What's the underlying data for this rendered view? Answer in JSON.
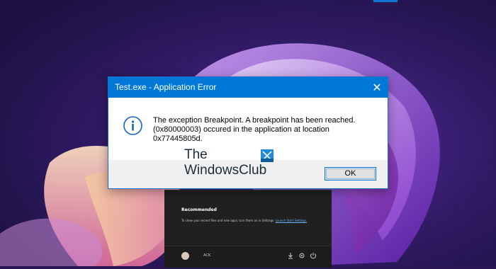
{
  "dialog": {
    "title": "Test.exe - Application Error",
    "close_glyph": "✕",
    "icon": "info-icon",
    "message_lines": [
      "The exception Breakpoint. A breakpoint has been reached.",
      "(0x80000003) occured in the application at location",
      "0x77445805d."
    ],
    "ok_label": "OK"
  },
  "watermark": {
    "line1": "The",
    "line2": "WindowsClub"
  },
  "start_menu": {
    "recommended_title": "Recommended",
    "recommended_text": "To show your recent files and new apps, turn them on in Settings.",
    "recommended_link": "Launch Start Settings.",
    "user_name": "ACK",
    "footer_icons": [
      "download-icon",
      "settings-icon",
      "power-icon"
    ]
  },
  "colors": {
    "title_bar": "#0078d7",
    "desktop_bg": "#2a1655",
    "button_bar": "#f0f0f0"
  }
}
